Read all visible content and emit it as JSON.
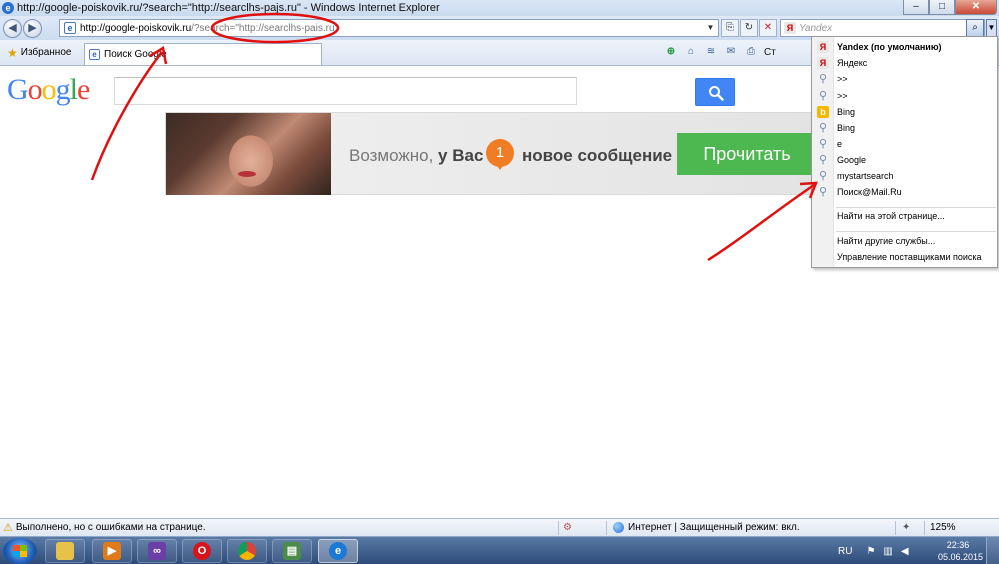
{
  "window": {
    "title": "http://google-poiskovik.ru/?search=\"http://searclhs-pajs.ru\" - Windows Internet Explorer",
    "minimize": "–",
    "maximize": "□",
    "close": "✕"
  },
  "address_bar": {
    "url_host": "http://google-poiskovik.ru",
    "url_query": "/?search=\"http://searclhs-pais.ru\""
  },
  "search_box": {
    "placeholder": "Yandex"
  },
  "favorites_bar": {
    "favorites_label": "Избранное",
    "tab_label": "Поиск Google",
    "page_menu_label": "Ст"
  },
  "google": {
    "logo_letters": [
      {
        "ch": "G",
        "color": "#4285f4"
      },
      {
        "ch": "o",
        "color": "#ea4335"
      },
      {
        "ch": "o",
        "color": "#fbbc05"
      },
      {
        "ch": "g",
        "color": "#4285f4"
      },
      {
        "ch": "l",
        "color": "#34a853"
      },
      {
        "ch": "e",
        "color": "#ea4335"
      }
    ]
  },
  "banner": {
    "text_gray": "Возможно,",
    "text_bold": "у Вас",
    "badge_count": "1",
    "text_after": "новое сообщение",
    "button_label": "Прочитать"
  },
  "search_providers": {
    "items": [
      {
        "label": "Yandex (по умолчанию)",
        "icon": "yandex-icon",
        "default": true
      },
      {
        "label": "Яндекс",
        "icon": "yandex-icon"
      },
      {
        "label": ">>",
        "icon": "search-icon"
      },
      {
        "label": ">>",
        "icon": "search-icon"
      },
      {
        "label": "Bing",
        "icon": "bing-icon"
      },
      {
        "label": "Bing",
        "icon": "search-icon"
      },
      {
        "label": "e",
        "icon": "search-icon"
      },
      {
        "label": "Google",
        "icon": "search-icon"
      },
      {
        "label": "mystartsearch",
        "icon": "search-icon"
      },
      {
        "label": "Поиск@Mail.Ru",
        "icon": "search-icon"
      }
    ],
    "find_on_page": "Найти на этой странице...",
    "find_more": "Найти другие службы...",
    "manage": "Управление поставщиками поиска"
  },
  "status_bar": {
    "message": "Выполнено, но с ошибками на странице.",
    "zone": "Интернет | Защищенный режим: вкл.",
    "zoom": "125%"
  },
  "taskbar": {
    "language": "RU",
    "time": "22:36",
    "date": "05.06.2015"
  }
}
